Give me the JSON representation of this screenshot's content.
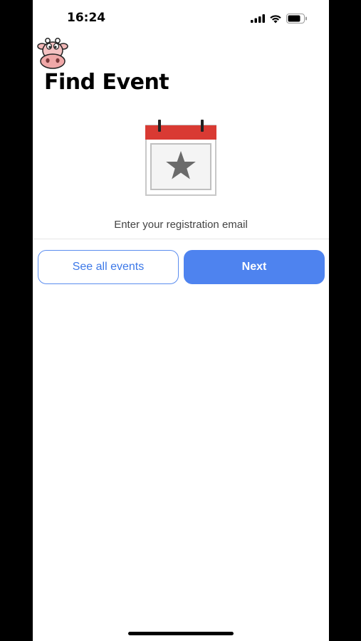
{
  "status_bar": {
    "time": "16:24"
  },
  "header": {
    "title": "Find Event"
  },
  "illustration": {
    "icon": "calendar-star-icon",
    "header_color": "#d93a33",
    "star_color": "#6b6b6b"
  },
  "form": {
    "email_placeholder": "Enter your registration email",
    "email_value": ""
  },
  "actions": {
    "see_all_label": "See all events",
    "next_label": "Next"
  },
  "colors": {
    "primary": "#4e83ef",
    "outline": "#5b8def"
  }
}
